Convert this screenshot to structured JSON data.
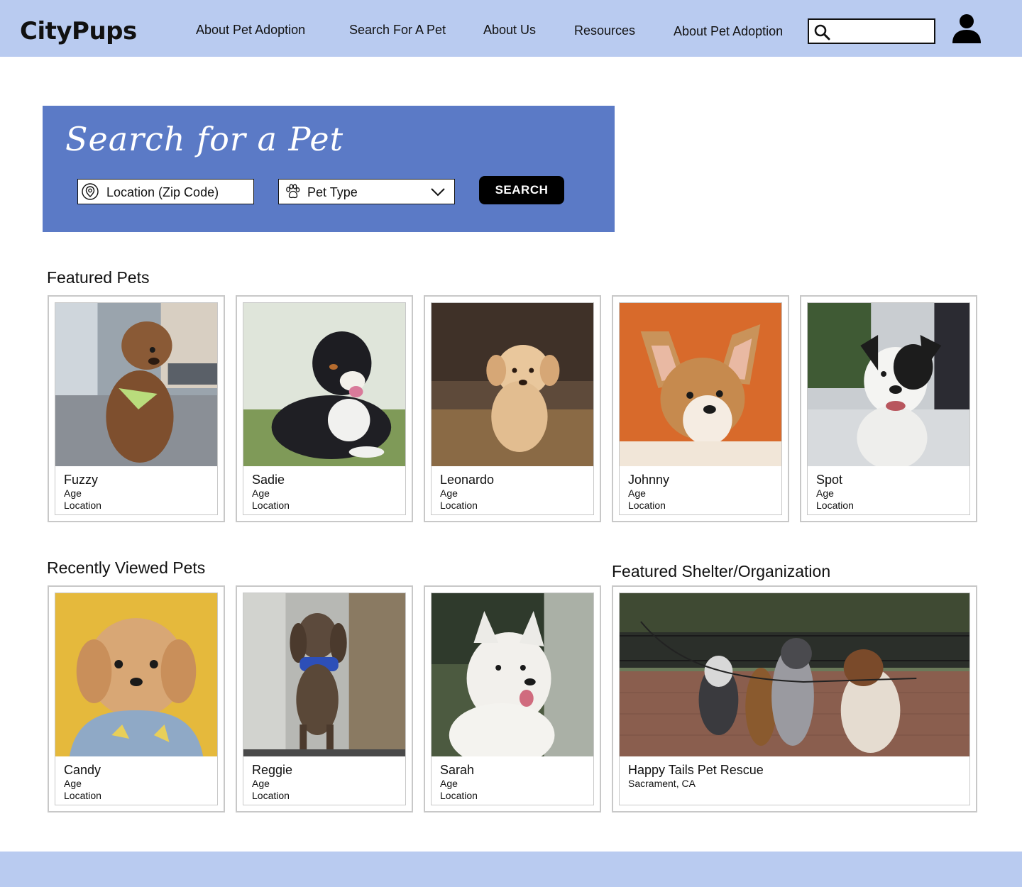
{
  "header": {
    "logo": "CityPups",
    "nav": [
      {
        "label": "About Pet Adoption"
      },
      {
        "label": "Search For A Pet"
      },
      {
        "label": "About Us"
      },
      {
        "label": "Resources"
      },
      {
        "label": "About Pet Adoption"
      }
    ],
    "search_value": ""
  },
  "search_panel": {
    "title": "Search for a Pet",
    "location_placeholder": "Location (Zip Code)",
    "pet_type_label": "Pet Type",
    "button_label": "SEARCH"
  },
  "featured": {
    "title": "Featured Pets",
    "pets": [
      {
        "name": "Fuzzy",
        "age": "Age",
        "location": "Location"
      },
      {
        "name": "Sadie",
        "age": "Age",
        "location": "Location"
      },
      {
        "name": "Leonardo",
        "age": "Age",
        "location": "Location"
      },
      {
        "name": "Johnny",
        "age": "Age",
        "location": "Location"
      },
      {
        "name": "Spot",
        "age": "Age",
        "location": "Location"
      }
    ]
  },
  "recent": {
    "title": "Recently Viewed Pets",
    "pets": [
      {
        "name": "Candy",
        "age": "Age",
        "location": "Location"
      },
      {
        "name": "Reggie",
        "age": "Age",
        "location": "Location"
      },
      {
        "name": "Sarah",
        "age": "Age",
        "location": "Location"
      }
    ]
  },
  "shelter": {
    "title": "Featured Shelter/Organization",
    "name": "Happy Tails Pet Rescue",
    "location": "Sacrament, CA"
  },
  "colors": {
    "header_bg": "#b9cbf0",
    "panel_bg": "#5b7ac6",
    "button_bg": "#000000"
  }
}
